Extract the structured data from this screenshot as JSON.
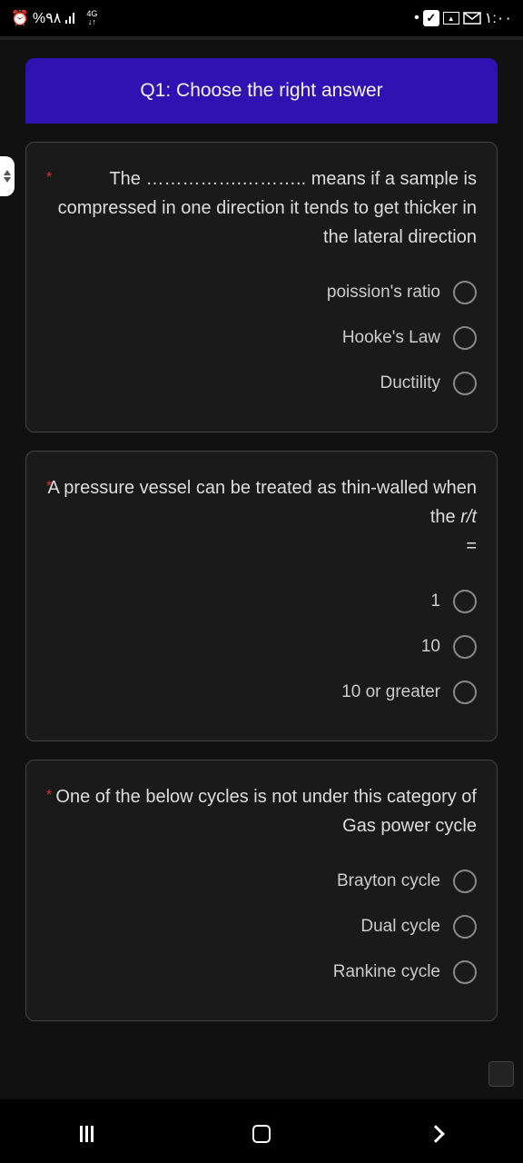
{
  "status": {
    "left": {
      "battery": "%٩٨",
      "net": "4G"
    },
    "right": {
      "time": "١:٠٠"
    }
  },
  "header": {
    "title": "Q1: Choose the right answer"
  },
  "questions": {
    "q1": {
      "text": "The …………….……….. means if a sample is compressed in one direction it tends to get thicker in the lateral direction",
      "options": {
        "a": "poission's ratio",
        "b": "Hooke's Law",
        "c": "Ductility"
      }
    },
    "q2": {
      "text": "A pressure vessel can be treated as thin-walled when the ",
      "italic": "r/t",
      "text2": "=",
      "options": {
        "a": "1",
        "b": "10",
        "c": "10 or greater"
      }
    },
    "q3": {
      "text": "One of the below cycles is not under this category of Gas power cycle",
      "options": {
        "a": "Brayton cycle",
        "b": "Dual cycle",
        "c": "Rankine cycle"
      }
    }
  }
}
